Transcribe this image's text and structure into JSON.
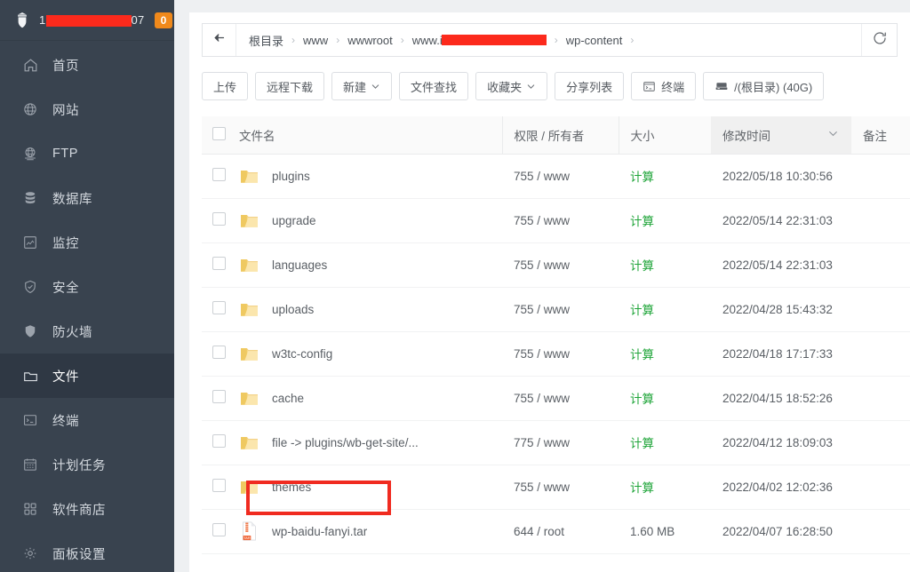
{
  "sidebar": {
    "brand": {
      "logo_icon": "shield-castle-icon",
      "text_prefix": "1",
      "text_suffix": "07",
      "badge": "0"
    },
    "items": [
      {
        "label": "首页",
        "icon": "home-icon",
        "active": false
      },
      {
        "label": "网站",
        "icon": "globe-icon",
        "active": false
      },
      {
        "label": "FTP",
        "icon": "ftp-globe-icon",
        "active": false
      },
      {
        "label": "数据库",
        "icon": "database-icon",
        "active": false
      },
      {
        "label": "监控",
        "icon": "monitor-icon",
        "active": false
      },
      {
        "label": "安全",
        "icon": "shield-check-icon",
        "active": false
      },
      {
        "label": "防火墙",
        "icon": "shield-solid-icon",
        "active": false
      },
      {
        "label": "文件",
        "icon": "folder-icon",
        "active": true
      },
      {
        "label": "终端",
        "icon": "terminal-icon",
        "active": false
      },
      {
        "label": "计划任务",
        "icon": "calendar-icon",
        "active": false
      },
      {
        "label": "软件商店",
        "icon": "grid-icon",
        "active": false
      },
      {
        "label": "面板设置",
        "icon": "gear-icon",
        "active": false
      }
    ]
  },
  "breadcrumb": {
    "back_icon": "arrow-left-icon",
    "refresh_icon": "refresh-icon",
    "separator": "›",
    "crumbs": [
      {
        "label": "根目录",
        "redacted": false
      },
      {
        "label": "www",
        "redacted": false
      },
      {
        "label": "wwwroot",
        "redacted": false
      },
      {
        "label": "www.i",
        "redacted": true
      },
      {
        "label": "wp-content",
        "redacted": false
      }
    ]
  },
  "toolbar": {
    "buttons": [
      {
        "label": "上传",
        "caret": false,
        "icon": null
      },
      {
        "label": "远程下载",
        "caret": false,
        "icon": null
      },
      {
        "label": "新建",
        "caret": true,
        "icon": null
      },
      {
        "label": "文件查找",
        "caret": false,
        "icon": null
      },
      {
        "label": "收藏夹",
        "caret": true,
        "icon": null
      },
      {
        "label": "分享列表",
        "caret": false,
        "icon": null
      },
      {
        "label": "终端",
        "caret": false,
        "icon": "terminal-icon"
      },
      {
        "label": "/(根目录) (40G)",
        "caret": false,
        "icon": "disk-icon"
      }
    ]
  },
  "table": {
    "columns": [
      "文件名",
      "权限 / 所有者",
      "大小",
      "修改时间",
      "备注"
    ],
    "sorted_column": "修改时间",
    "sort_icon": "chevron-down-icon",
    "rows": [
      {
        "name": "plugins",
        "type": "folder",
        "perm": "755 / www",
        "size": "计算",
        "time": "2022/05/18 10:30:56",
        "note": "",
        "highlighted": false
      },
      {
        "name": "upgrade",
        "type": "folder",
        "perm": "755 / www",
        "size": "计算",
        "time": "2022/05/14 22:31:03",
        "note": "",
        "highlighted": false
      },
      {
        "name": "languages",
        "type": "folder",
        "perm": "755 / www",
        "size": "计算",
        "time": "2022/05/14 22:31:03",
        "note": "",
        "highlighted": false
      },
      {
        "name": "uploads",
        "type": "folder",
        "perm": "755 / www",
        "size": "计算",
        "time": "2022/04/28 15:43:32",
        "note": "",
        "highlighted": false
      },
      {
        "name": "w3tc-config",
        "type": "folder",
        "perm": "755 / www",
        "size": "计算",
        "time": "2022/04/18 17:17:33",
        "note": "",
        "highlighted": false
      },
      {
        "name": "cache",
        "type": "folder",
        "perm": "755 / www",
        "size": "计算",
        "time": "2022/04/15 18:52:26",
        "note": "",
        "highlighted": false
      },
      {
        "name": "file -> plugins/wb-get-site/...",
        "type": "folder",
        "perm": "775 / www",
        "size": "计算",
        "time": "2022/04/12 18:09:03",
        "note": "",
        "highlighted": false
      },
      {
        "name": "themes",
        "type": "folder",
        "perm": "755 / www",
        "size": "计算",
        "time": "2022/04/02 12:02:36",
        "note": "",
        "highlighted": true
      },
      {
        "name": "wp-baidu-fanyi.tar",
        "type": "tar",
        "perm": "644 / root",
        "size": "1.60 MB",
        "time": "2022/04/07 16:28:50",
        "note": "",
        "highlighted": false
      }
    ]
  },
  "annotation": {
    "shape": "red-rectangle",
    "color": "#f02b20",
    "target": "themes"
  },
  "colors": {
    "sidebar_bg": "#39434f",
    "sidebar_active": "#2f3844",
    "badge_orange": "#f0891b",
    "redaction_red": "#fc2a1c",
    "link_green": "#20a53a",
    "annotation_red": "#f02b20"
  }
}
